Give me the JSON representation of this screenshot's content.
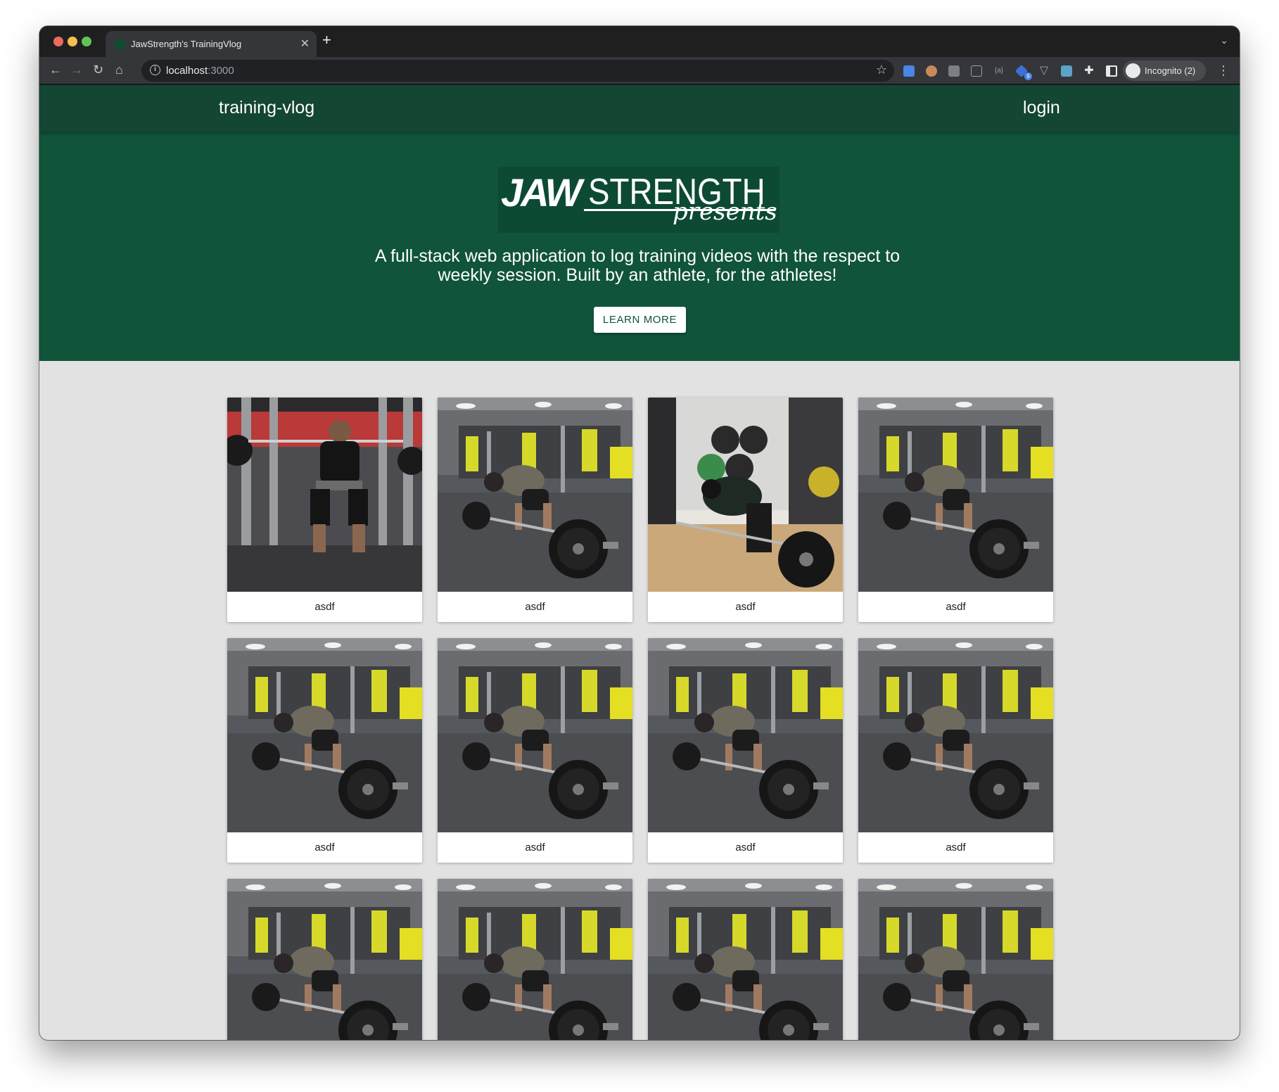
{
  "browser": {
    "tab_title": "JawStrength's TrainingVlog",
    "url_host": "localhost",
    "url_port": ":3000",
    "profile_label": "Incognito (2)",
    "extension_badge": "9"
  },
  "appbar": {
    "brand": "training-vlog",
    "login": "login"
  },
  "hero": {
    "logo_bold": "JAW",
    "logo_light": "STRENGTH",
    "logo_script": "presents",
    "tagline_line1": "A full-stack web application to log training videos with the respect to",
    "tagline_line2": "weekly session. Built by an athlete, for the athletes!",
    "cta_label": "LEARN MORE"
  },
  "videos": [
    {
      "title": "asdf",
      "thumbnail": "squat"
    },
    {
      "title": "asdf",
      "thumbnail": "deadlift"
    },
    {
      "title": "asdf",
      "thumbnail": "row"
    },
    {
      "title": "asdf",
      "thumbnail": "deadlift"
    },
    {
      "title": "asdf",
      "thumbnail": "deadlift"
    },
    {
      "title": "asdf",
      "thumbnail": "deadlift"
    },
    {
      "title": "asdf",
      "thumbnail": "deadlift"
    },
    {
      "title": "asdf",
      "thumbnail": "deadlift"
    },
    {
      "title": "",
      "thumbnail": "deadlift"
    },
    {
      "title": "",
      "thumbnail": "deadlift"
    },
    {
      "title": "",
      "thumbnail": "deadlift"
    },
    {
      "title": "",
      "thumbnail": "deadlift"
    }
  ],
  "colors": {
    "appbar": "#134633",
    "hero": "#10543a",
    "page_bg": "#e2e2e2"
  }
}
